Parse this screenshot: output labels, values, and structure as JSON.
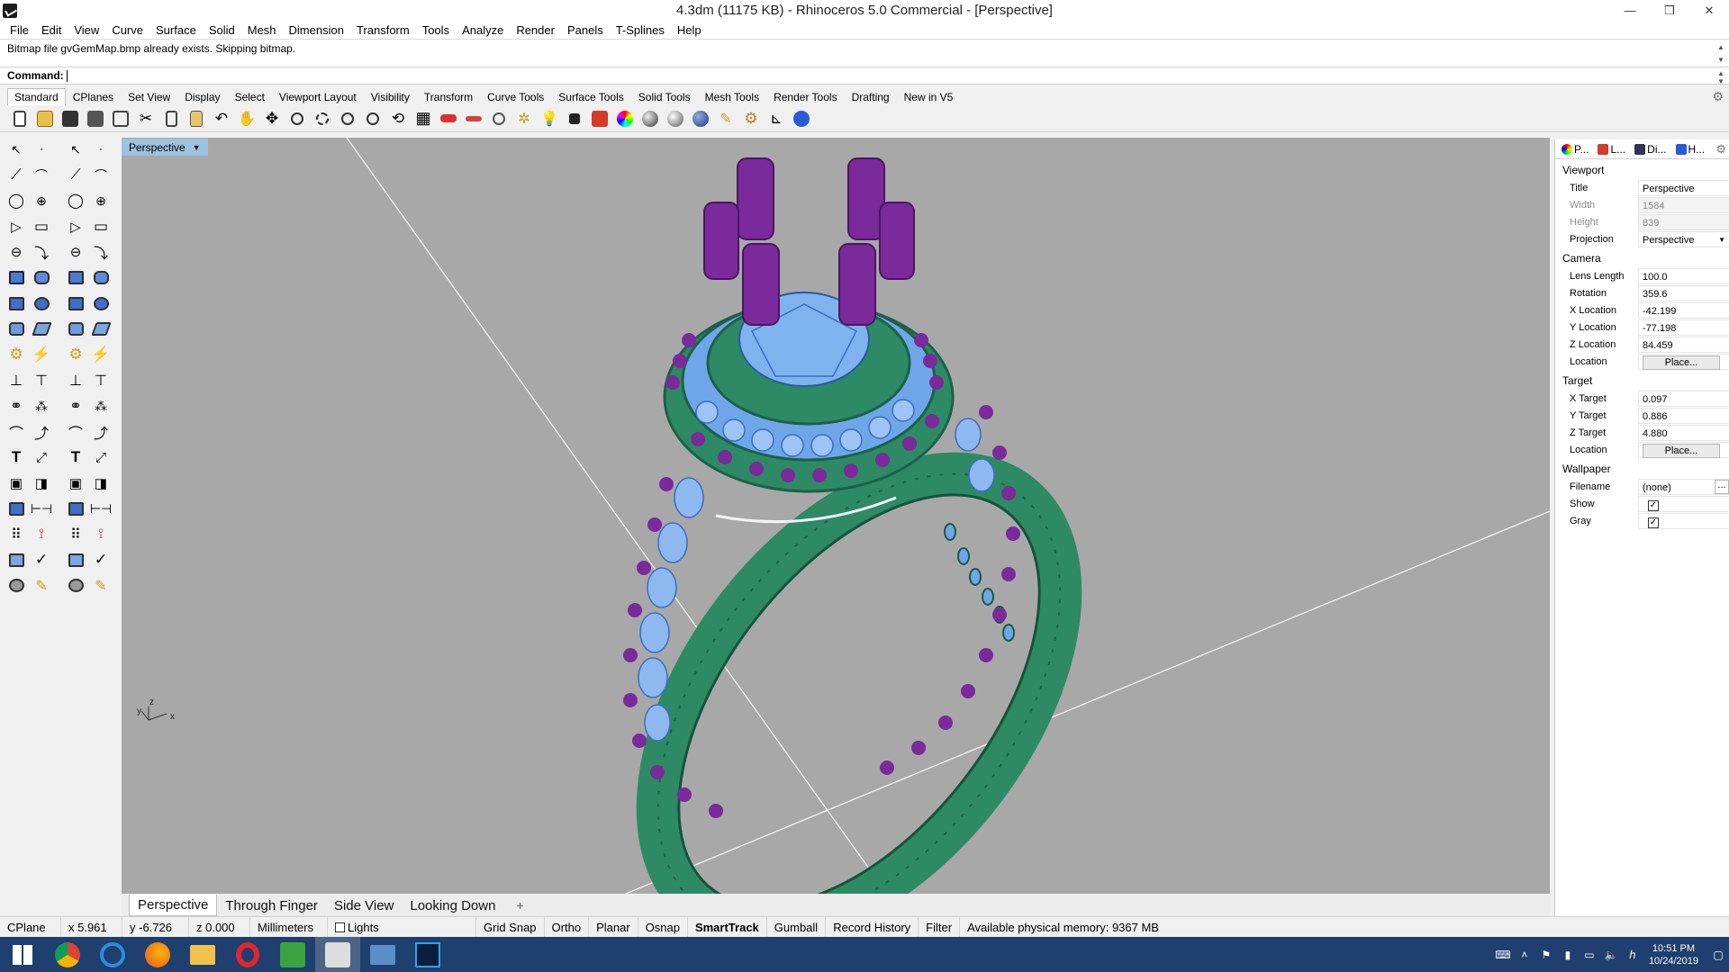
{
  "window": {
    "title": "4.3dm (11175 KB) - Rhinoceros 5.0 Commercial - [Perspective]",
    "controls": [
      "—",
      "❐",
      "✕"
    ]
  },
  "menu": [
    "File",
    "Edit",
    "View",
    "Curve",
    "Surface",
    "Solid",
    "Mesh",
    "Dimension",
    "Transform",
    "Tools",
    "Analyze",
    "Render",
    "Panels",
    "T-Splines",
    "Help"
  ],
  "command": {
    "history": "Bitmap file gvGemMap.bmp already exists. Skipping bitmap.",
    "prompt": "Command:",
    "value": ""
  },
  "toolbar_tabs": [
    "Standard",
    "CPlanes",
    "Set View",
    "Display",
    "Select",
    "Viewport Layout",
    "Visibility",
    "Transform",
    "Curve Tools",
    "Surface Tools",
    "Solid Tools",
    "Mesh Tools",
    "Render Tools",
    "Drafting",
    "New in V5"
  ],
  "toolbar_icons": [
    "new-file-icon",
    "open-folder-icon",
    "save-icon",
    "print-icon",
    "import-icon",
    "cut-icon",
    "copy-icon",
    "paste-icon",
    "undo-icon",
    "pan-hand-icon",
    "move-view-icon",
    "zoom-icon",
    "zoom-window-icon",
    "zoom-extents-icon",
    "zoom-selected-icon",
    "rotate-view-icon",
    "grid-viewport-icon",
    "car-render-icon",
    "construction-plane-icon",
    "circle-tool-icon",
    "star-snap-icon",
    "light-bulb-icon",
    "lock-icon",
    "material-icon",
    "color-wheel-icon",
    "sphere-shaded-icon",
    "sphere-render-icon",
    "blue-sphere-icon",
    "marker-icon",
    "settings-gear-icon",
    "dimension-icon",
    "help-icon"
  ],
  "viewport": {
    "label": "Perspective",
    "tabs": [
      "Perspective",
      "Through Finger",
      "Side View",
      "Looking Down"
    ],
    "axes": {
      "x": "x",
      "y": "y",
      "z": "z"
    }
  },
  "properties_panel": {
    "tabs": [
      "P...",
      "L...",
      "Di...",
      "H..."
    ],
    "viewport_header": "Viewport",
    "viewport": [
      {
        "k": "Title",
        "v": "Perspective"
      },
      {
        "k": "Width",
        "v": "1584"
      },
      {
        "k": "Height",
        "v": "839"
      },
      {
        "k": "Projection",
        "v": "Perspective"
      }
    ],
    "camera_header": "Camera",
    "camera": [
      {
        "k": "Lens Length",
        "v": "100.0"
      },
      {
        "k": "Rotation",
        "v": "359.6"
      },
      {
        "k": "X Location",
        "v": "-42.199"
      },
      {
        "k": "Y Location",
        "v": "-77.198"
      },
      {
        "k": "Z Location",
        "v": "84.459"
      },
      {
        "k": "Location",
        "v": "Place..."
      }
    ],
    "target_header": "Target",
    "target": [
      {
        "k": "X Target",
        "v": "0.097"
      },
      {
        "k": "Y Target",
        "v": "0.886"
      },
      {
        "k": "Z Target",
        "v": "4.880"
      },
      {
        "k": "Location",
        "v": "Place..."
      }
    ],
    "wallpaper_header": "Wallpaper",
    "wallpaper": [
      {
        "k": "Filename",
        "v": "(none)"
      },
      {
        "k": "Show",
        "v": "✓"
      },
      {
        "k": "Gray",
        "v": "✓"
      }
    ]
  },
  "status": {
    "cplane": "CPlane",
    "x": "x 5.961",
    "y": "y -6.726",
    "z": "z 0.000",
    "units": "Millimeters",
    "layer": "Lights",
    "grid_snap": "Grid Snap",
    "ortho": "Ortho",
    "planar": "Planar",
    "osnap": "Osnap",
    "smarttrack": "SmartTrack",
    "gumball": "Gumball",
    "record_history": "Record History",
    "filter": "Filter",
    "memory": "Available physical memory: 9367 MB"
  },
  "taskbar": {
    "apps": [
      "start-windows-icon",
      "chrome-icon",
      "internet-explorer-icon",
      "firefox-icon",
      "file-explorer-icon",
      "opera-icon",
      "camtasia-icon",
      "rhino-icon",
      "remote-desktop-icon",
      "photoshop-icon"
    ],
    "time": "10:51 PM",
    "date": "10/24/2019"
  },
  "colors": {
    "viewport_bg": "#a8a8a8",
    "ring_shank": "#1f7a5a",
    "gem_blue": "#7fb3f0",
    "prong_purple": "#7a2a9a",
    "taskbar": "#1f3f6e"
  }
}
